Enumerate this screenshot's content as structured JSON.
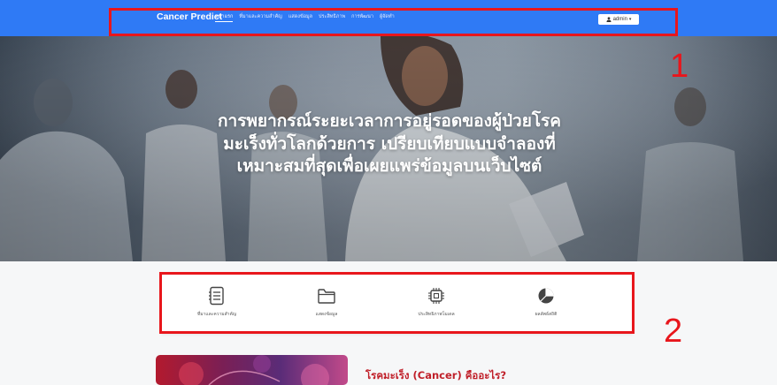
{
  "navbar": {
    "brand": "Cancer Predict",
    "links": [
      {
        "label": "หน้าแรก",
        "active": true
      },
      {
        "label": "ที่มาและความสำคัญ",
        "active": false
      },
      {
        "label": "แสดงข้อมูล",
        "active": false
      },
      {
        "label": "ประสิทธิภาพ",
        "active": false
      },
      {
        "label": "การพัฒนา",
        "active": false
      },
      {
        "label": "ผู้จัดทำ",
        "active": false
      }
    ],
    "user": {
      "name": "admin",
      "icon": "user-icon",
      "caret": "▾"
    }
  },
  "hero": {
    "lines": [
      "การพยากรณ์ระยะเวลาการอยู่รอดของผู้ป่วยโรค",
      "มะเร็งทั่วโลกด้วยการ เปรียบเทียบแบบจำลองที่",
      "เหมาะสมที่สุดเพื่อเผยแพร่ข้อมูลบนเว็บไซต์"
    ]
  },
  "features": [
    {
      "label": "ที่มาและความสำคัญ",
      "icon": "document-list-icon"
    },
    {
      "label": "แสดงข้อมูล",
      "icon": "folder-icon"
    },
    {
      "label": "ประสิทธิภาพโมเดล",
      "icon": "cpu-chip-icon"
    },
    {
      "label": "ผลลัพธ์สถิติ",
      "icon": "pie-chart-icon"
    }
  ],
  "section": {
    "title": "โรคมะเร็ง (Cancer) คืออะไร?"
  },
  "annotations": [
    {
      "number": "1",
      "color": "#e8161c"
    },
    {
      "number": "2",
      "color": "#e8161c"
    }
  ],
  "colors": {
    "navbar": "#2f7af5",
    "annotation": "#e8161c",
    "section_title": "#c0202a"
  }
}
